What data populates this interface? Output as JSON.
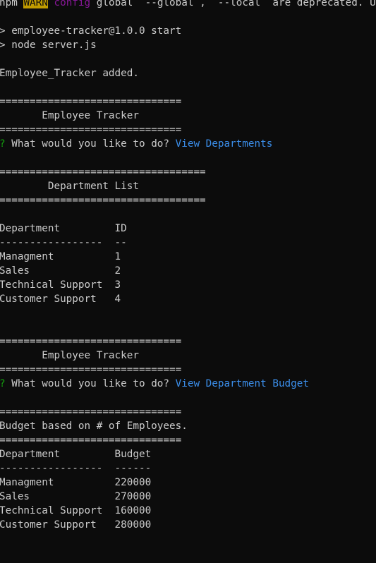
{
  "terminal": {
    "colors": {
      "background": "#0c0c0c",
      "foreground": "#cccccc",
      "warn_badge_bg": "#c19c00",
      "config_keyword": "#881798",
      "prompt_question_mark": "#13a10e",
      "selected_answer": "#3b8eea"
    },
    "warn_line": {
      "prefix": "npm ",
      "badge": "WARN",
      "keyword": " config",
      "rest": " global  --global ,  --local  are deprecated. Use --location=global instead."
    },
    "script_line": "> employee-tracker@1.0.0 start",
    "node_line": "> node server.js",
    "added_line": "Employee_Tracker added.",
    "banner1": {
      "rule": "==============================",
      "title": "       Employee Tracker"
    },
    "prompt1": {
      "mark": "?",
      "question": " What would you like to do? ",
      "answer": "View Departments"
    },
    "dept_banner": {
      "rule": "==================================",
      "title": "        Department List"
    },
    "dept_table": {
      "header": "Department         ID",
      "divider": "-----------------  --",
      "rows": [
        "Managment          1",
        "Sales              2",
        "Technical Support  3",
        "Customer Support   4"
      ]
    },
    "banner2": {
      "rule": "==============================",
      "title": "       Employee Tracker"
    },
    "prompt2": {
      "mark": "?",
      "question": " What would you like to do? ",
      "answer": "View Department Budget"
    },
    "budget_banner": {
      "rule": "==============================",
      "title": "Budget based on # of Employees."
    },
    "budget_table": {
      "header": "Department         Budget",
      "divider": "-----------------  ------",
      "rows": [
        "Managment          220000",
        "Sales              270000",
        "Technical Support  160000",
        "Customer Support   280000"
      ]
    }
  }
}
